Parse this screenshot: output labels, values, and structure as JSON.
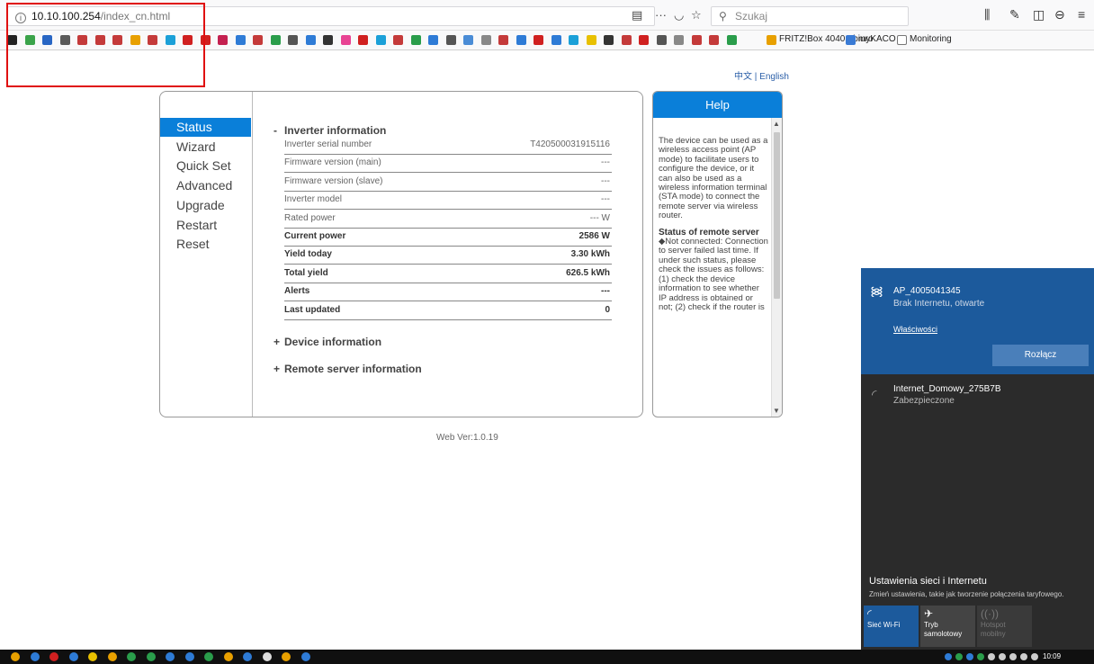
{
  "browser": {
    "url_host": "10.10.100.254",
    "url_path": "/index_cn.html",
    "page_actions": "···",
    "search_placeholder": "Szukaj",
    "bookmarks": [
      {
        "label": "FRITZ!Box 4040 - biuro"
      },
      {
        "label": "myKACO"
      },
      {
        "label": "Monitoring"
      }
    ]
  },
  "page": {
    "language_links": {
      "cn": "中文",
      "separator": "|",
      "en": "English"
    },
    "menu": [
      {
        "label": "Status",
        "active": true
      },
      {
        "label": "Wizard",
        "active": false
      },
      {
        "label": "Quick Set",
        "active": false
      },
      {
        "label": "Advanced",
        "active": false
      },
      {
        "label": "Upgrade",
        "active": false
      },
      {
        "label": "Restart",
        "active": false
      },
      {
        "label": "Reset",
        "active": false
      }
    ],
    "inverter_section": {
      "toggle": "-",
      "title": "Inverter information",
      "rows": [
        {
          "label": "Inverter serial number",
          "value": "T420500031915116",
          "bold": false
        },
        {
          "label": "Firmware version (main)",
          "value": "---",
          "bold": false
        },
        {
          "label": "Firmware version (slave)",
          "value": "---",
          "bold": false
        },
        {
          "label": "Inverter model",
          "value": "---",
          "bold": false
        },
        {
          "label": "Rated power",
          "value": "--- W",
          "bold": false
        },
        {
          "label": "Current power",
          "value": "2586 W",
          "bold": true
        },
        {
          "label": "Yield today",
          "value": "3.30 kWh",
          "bold": true
        },
        {
          "label": "Total yield",
          "value": "626.5 kWh",
          "bold": true
        },
        {
          "label": "Alerts",
          "value": "---",
          "bold": true
        },
        {
          "label": "Last updated",
          "value": "0",
          "bold": true
        }
      ]
    },
    "device_section": {
      "toggle": "+",
      "title": "Device information"
    },
    "remote_section": {
      "toggle": "+",
      "title": "Remote server information"
    },
    "web_version": "Web Ver:1.0.19",
    "help": {
      "title": "Help",
      "intro": "The device can be used as a wireless access point (AP mode) to facilitate users to configure the device, or it can also be used as a wireless information terminal (STA mode) to connect the remote server via wireless router.",
      "status_title": "Status of remote server",
      "status_text": "◆Not connected: Connection to server failed last time. If under such status, please check the issues as follows: (1) check the device information to see whether IP address is obtained or not; (2) check if the router is"
    }
  },
  "wifi_flyout": {
    "connected": {
      "ssid": "AP_4005041345",
      "status": "Brak Internetu, otwarte",
      "properties": "Właściwości",
      "disconnect": "Rozłącz"
    },
    "other": {
      "ssid": "Internet_Domowy_275B7B",
      "status": "Zabezpieczone"
    },
    "settings_title": "Ustawienia sieci i Internetu",
    "settings_sub": "Zmień ustawienia, takie jak tworzenie połączenia taryfowego.",
    "quick_actions": [
      {
        "label": "Sieć Wi-Fi",
        "active": true
      },
      {
        "label": "Tryb samolotowy",
        "active": false
      },
      {
        "label": "Hotspot mobilny",
        "active": false,
        "disabled": true
      }
    ]
  },
  "taskbar": {
    "time": "10:09"
  },
  "colors": {
    "accent": "#0a7fd9",
    "highlight": "#e01010",
    "wifi_selected": "#1c5a9c"
  }
}
